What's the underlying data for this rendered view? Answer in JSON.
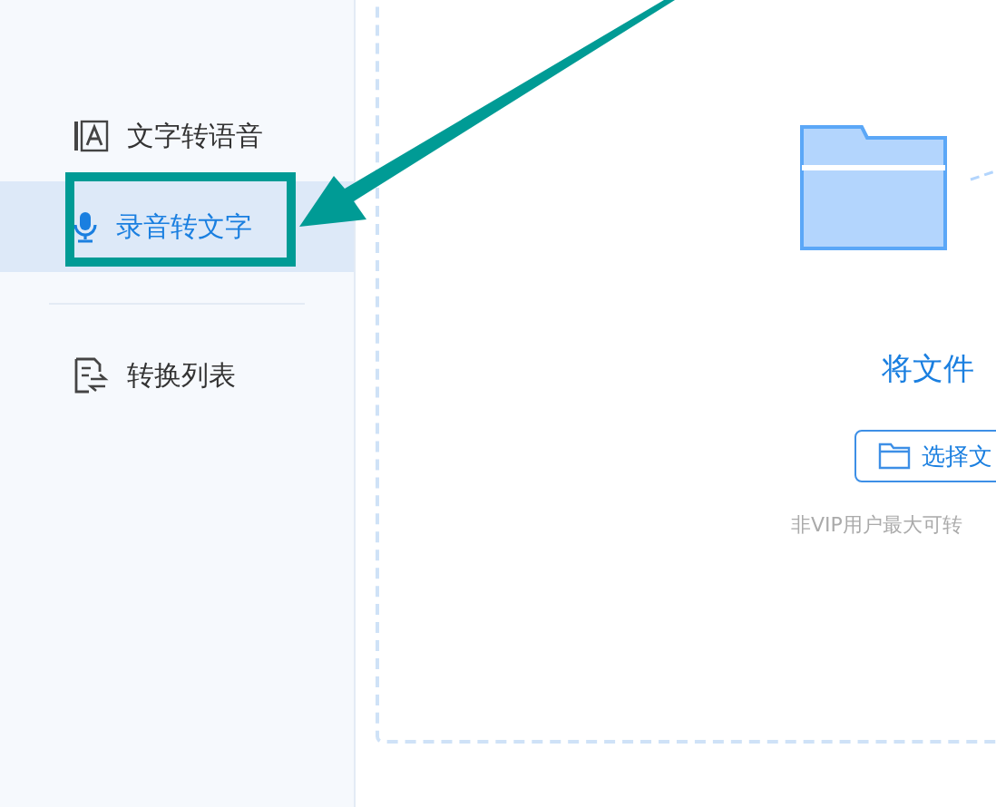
{
  "sidebar": {
    "items": [
      {
        "label": "文字转语音",
        "kind": "text-to-speech",
        "selected": false
      },
      {
        "label": "录音转文字",
        "kind": "speech-to-text",
        "selected": true
      },
      {
        "label": "转换列表",
        "kind": "list",
        "selected": false
      }
    ]
  },
  "upload": {
    "title": "将文件",
    "button": "选择文",
    "note": "非VIP用户最大可转"
  }
}
